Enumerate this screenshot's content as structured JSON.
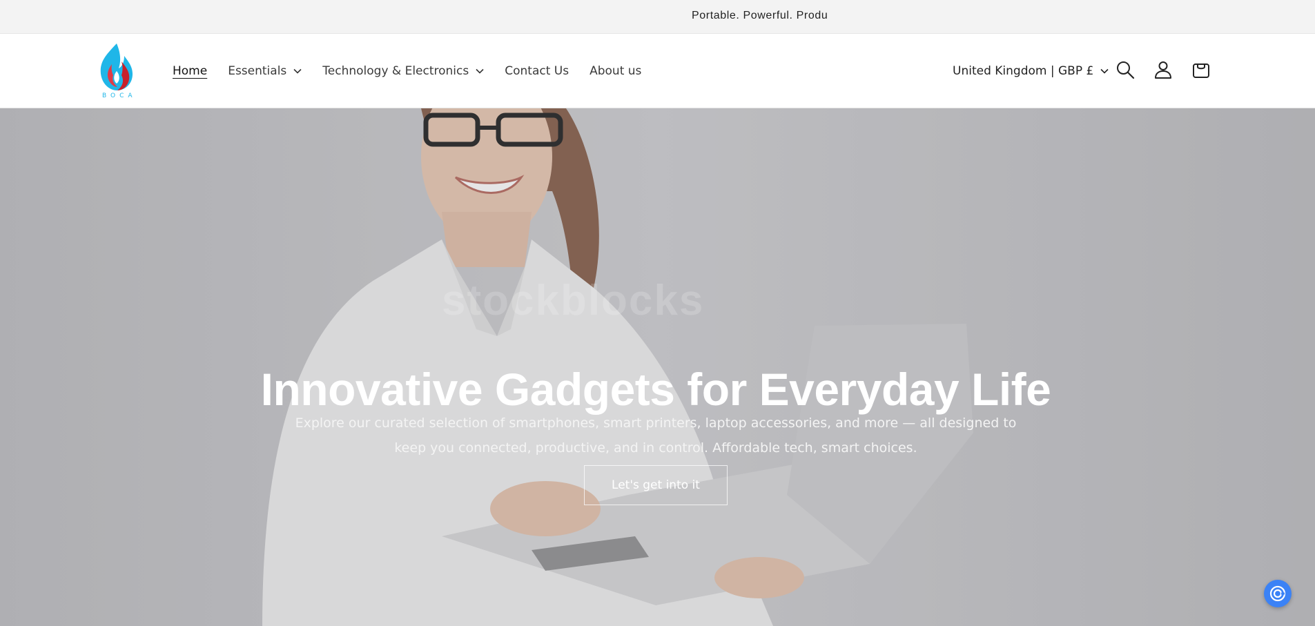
{
  "announcement": {
    "text": "Portable. Powerful. Produ"
  },
  "header": {
    "logo_alt": "BOCA",
    "nav": [
      {
        "label": "Home",
        "active": true,
        "has_dropdown": false
      },
      {
        "label": "Essentials",
        "active": false,
        "has_dropdown": true
      },
      {
        "label": "Technology & Electronics",
        "active": false,
        "has_dropdown": true
      },
      {
        "label": "Contact Us",
        "active": false,
        "has_dropdown": false
      },
      {
        "label": "About us",
        "active": false,
        "has_dropdown": false
      }
    ],
    "country_selector": "United Kingdom | GBP £",
    "icons": [
      "search-icon",
      "account-icon",
      "cart-icon"
    ]
  },
  "hero": {
    "watermark": "stockblocks",
    "title": "Innovative Gadgets for Everyday Life",
    "subtitle": "Explore our curated selection of smartphones, smart printers, laptop accessories, and more — all designed to keep you connected, productive, and in control. Affordable tech, smart choices.",
    "button_label": "Let's get into it"
  },
  "colors": {
    "announcement_bg": "#f3f3f3",
    "hero_overlay": "#c9c9cb",
    "chat_button": "#3b82f6"
  }
}
